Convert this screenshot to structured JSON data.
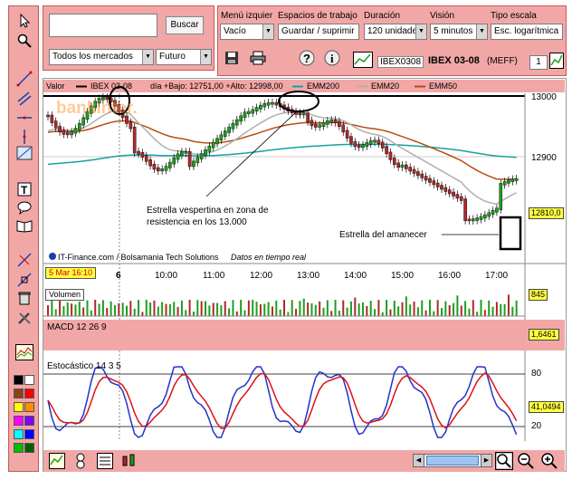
{
  "search": {
    "button": "Buscar"
  },
  "market": {
    "value": "Todos los mercados",
    "type": "Futuro"
  },
  "toolbar": {
    "menu_label": "Menú izquier",
    "menu_value": "Vacío",
    "spaces_label": "Espacios de trabajo",
    "spaces_value": "Guardar / suprimir",
    "duration_label": "Duración",
    "duration_value": "120 unidades",
    "view_label": "Visión",
    "view_value": "5 minutos",
    "scale_label": "Tipo escala",
    "scale_value": "Esc. logarítmica"
  },
  "instrument": {
    "code": "IBEX0308",
    "name": "IBEX 03-08",
    "market": "(MEFF)",
    "count": "1"
  },
  "legend": {
    "valor": "Valor",
    "series_name": "IBEX 03-08",
    "day_info": "día +Bajo: 12751,00 +Alto: 12998,00",
    "emm200": "EMM200",
    "emm20": "EMM20",
    "emm50": "EMM50"
  },
  "chart_data": {
    "type": "line",
    "price_axis": [
      13000,
      12900
    ],
    "last_price": "12810,0",
    "time_labels": [
      "6",
      "10:00",
      "11:00",
      "12:00",
      "13:00",
      "14:00",
      "15:00",
      "16:00",
      "17:00"
    ],
    "date_tag": "5 Mar 16:10",
    "ema_colors": {
      "EMM200": "#13a3a3",
      "EMM20": "#b0b0b0",
      "EMM50": "#b84d12"
    }
  },
  "annotations": {
    "evening_star_line1": "Estrella vespertina en zona de",
    "evening_star_line2": "resistencia en los 13.000",
    "morning_star": "Estrella del amanecer",
    "source": "IT-Finance.com / Bolsamania Tech Solutions",
    "delayed": "Datos en tiempo real",
    "watermark": "bankinter."
  },
  "panels": {
    "volume": {
      "label": "Volumen",
      "value": "845"
    },
    "macd": {
      "label": "MACD 12 26 9",
      "value": "1,6461"
    },
    "stoch": {
      "label": "Estocástico 14 3 5",
      "value": "41,0494",
      "level_high": "80",
      "level_low": "20"
    }
  },
  "colors": {
    "panel_bg": "#f2a7a7",
    "accent": "#ff0000",
    "candle_up": "#1f9e1f",
    "candle_down": "#b0272d"
  }
}
